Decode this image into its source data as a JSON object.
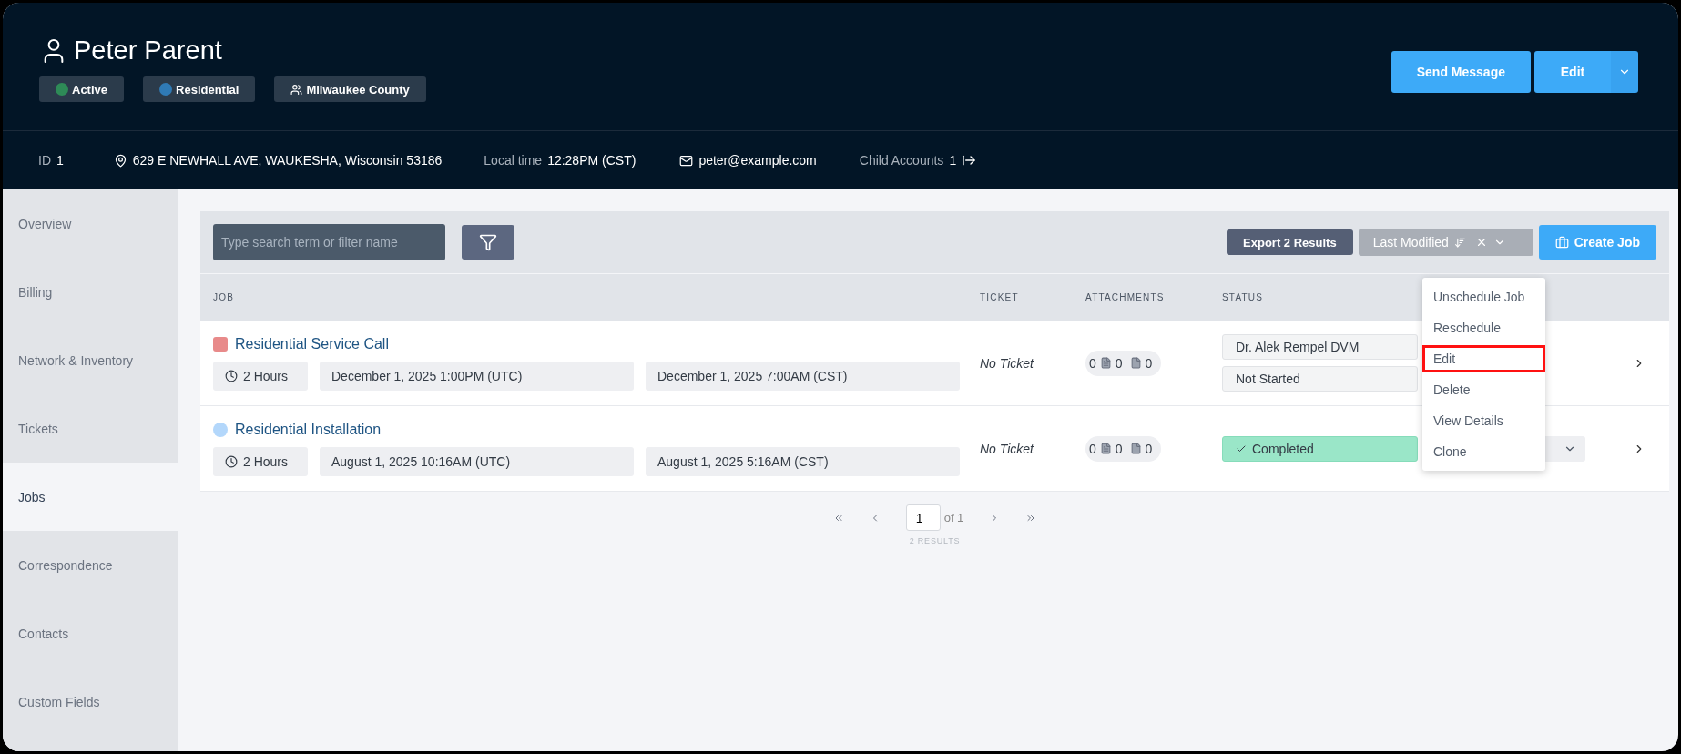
{
  "profile": {
    "name": "Peter Parent",
    "tags": [
      {
        "label": "Active",
        "kind": "dot",
        "color": "#2e8b57"
      },
      {
        "label": "Residential",
        "kind": "dot",
        "color": "#2f7ab5"
      },
      {
        "label": "Milwaukee County",
        "kind": "group"
      }
    ]
  },
  "header_actions": {
    "send_message": "Send Message",
    "edit": "Edit"
  },
  "info": [
    {
      "kind": "id",
      "label": "ID",
      "value": "1"
    },
    {
      "kind": "address",
      "value": "629 E NEWHALL AVE, WAUKESHA, Wisconsin 53186"
    },
    {
      "kind": "time",
      "label": "Local time",
      "value": "12:28PM (CST)"
    },
    {
      "kind": "email",
      "value": "peter@example.com"
    },
    {
      "kind": "link",
      "label": "Child Accounts",
      "value": "1"
    }
  ],
  "sidebar": {
    "items": [
      {
        "label": "Overview",
        "selected": false
      },
      {
        "label": "Billing",
        "selected": false
      },
      {
        "label": "Network & Inventory",
        "selected": false
      },
      {
        "label": "Tickets",
        "selected": false
      },
      {
        "label": "Jobs",
        "selected": true
      },
      {
        "label": "Correspondence",
        "selected": false
      },
      {
        "label": "Contacts",
        "selected": false
      },
      {
        "label": "Custom Fields",
        "selected": false
      }
    ]
  },
  "toolbar": {
    "search": {
      "placeholder": "Type search term or filter name"
    },
    "export": "Export 2 Results",
    "sort": {
      "label": "Last Modified"
    },
    "create": "Create Job"
  },
  "table": {
    "columns": [
      "JOB",
      "TICKET",
      "ATTACHMENTS",
      "STATUS"
    ],
    "rows": [
      {
        "title": "Residential Service Call",
        "marker": {
          "kind": "square",
          "color": "#e88a8a"
        },
        "duration": "2 Hours",
        "start": "December 1, 2025 1:00PM (UTC)",
        "local": "December 1, 2025 7:00AM (CST)",
        "ticket": "No Ticket",
        "attachments": [
          "0",
          "0",
          "0"
        ],
        "status": [
          {
            "label": "Dr. Alek Rempel DVM",
            "kind": "plain"
          },
          {
            "label": "Not Started",
            "kind": "plain"
          }
        ],
        "action_select": false
      },
      {
        "title": "Residential Installation",
        "marker": {
          "kind": "circle",
          "color": "#b3d7fb"
        },
        "duration": "2 Hours",
        "start": "August 1, 2025 10:16AM (UTC)",
        "local": "August 1, 2025 5:16AM (CST)",
        "ticket": "No Ticket",
        "attachments": [
          "0",
          "0",
          "0"
        ],
        "status": [
          {
            "label": "Completed",
            "kind": "completed"
          }
        ],
        "action_select": true
      }
    ]
  },
  "menu": {
    "items": [
      {
        "label": "Unschedule Job",
        "highlighted": false
      },
      {
        "label": "Reschedule",
        "highlighted": false
      },
      {
        "label": "Edit",
        "highlighted": true
      },
      {
        "label": "Delete",
        "highlighted": false
      },
      {
        "label": "View Details",
        "highlighted": false
      },
      {
        "label": "Clone",
        "highlighted": false
      }
    ]
  },
  "pagination": {
    "page": "1",
    "of": "of 1",
    "results": "2 RESULTS"
  }
}
